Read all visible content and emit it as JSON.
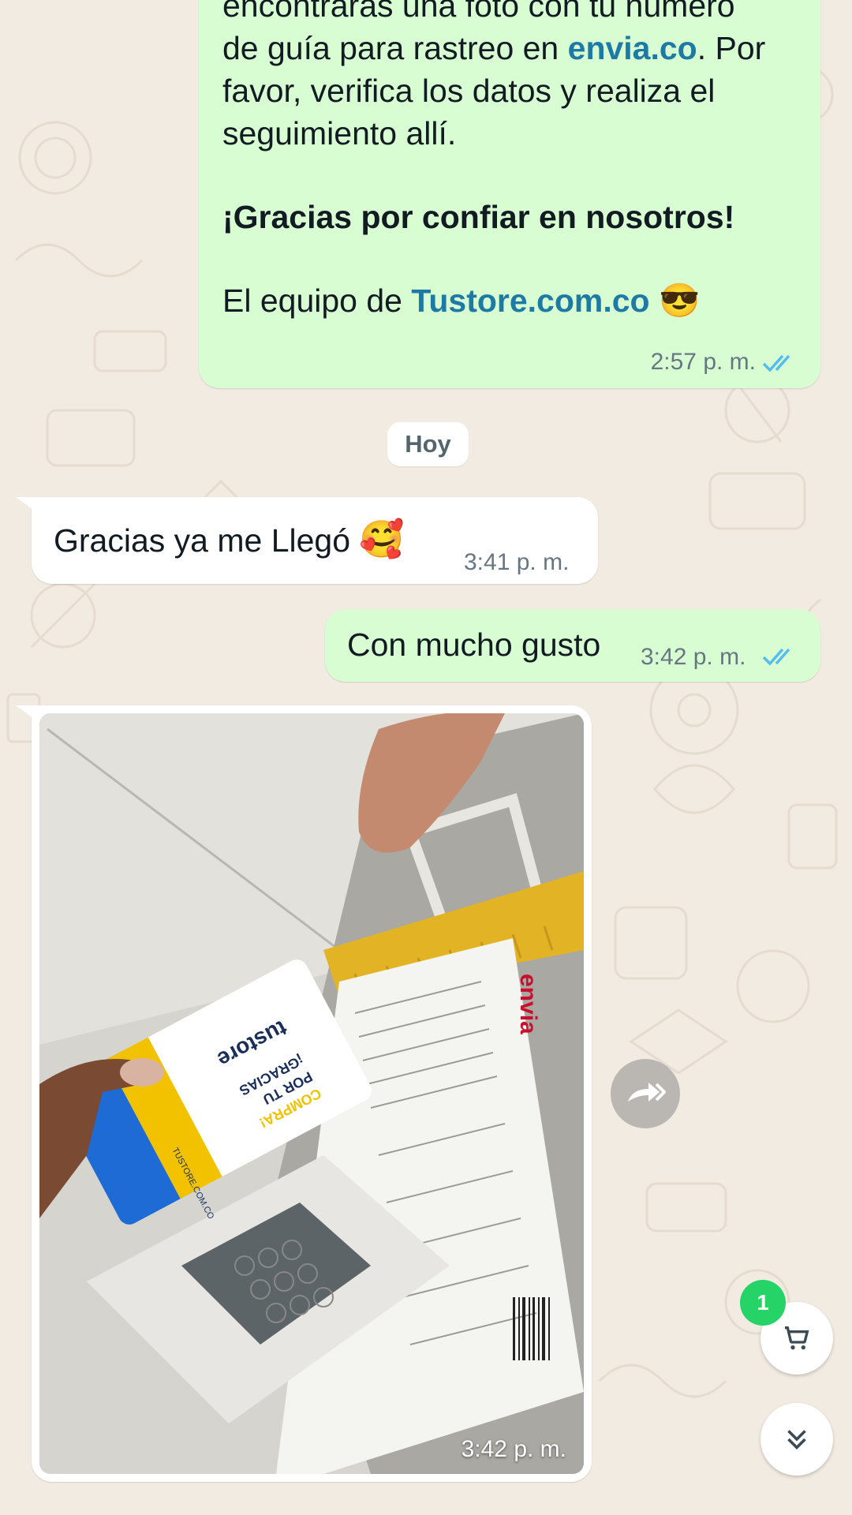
{
  "theme": {
    "outgoing_bubble": "#d9fdd3",
    "incoming_bubble": "#ffffff",
    "link": "#1d7aa5",
    "read_ticks": "#53bdeb",
    "badge": "#25d366",
    "background": "#f2ebe2"
  },
  "messages": {
    "first": {
      "line0": "encontrarás una foto con tu número",
      "line1_pre": "de guía para rastreo en ",
      "line1_link": "envia.co",
      "line1_post": ". Por",
      "line2": "favor, verifica los datos y realiza el",
      "line3": "seguimiento allí.",
      "thanks": "¡Gracias por confiar en nosotros!",
      "team_pre": "El equipo de ",
      "team_link": "Tustore.com.co",
      "emoji": "😎",
      "time": "2:57 p. m."
    },
    "date_separator": "Hoy",
    "incoming": {
      "text": "Gracias ya me Llegó",
      "emoji": "🥰",
      "time": "3:41 p. m."
    },
    "reply": {
      "text": "Con mucho gusto",
      "time": "3:42 p. m."
    },
    "photo": {
      "time": "3:42 p. m.",
      "card_brand": "tustore",
      "card_text_1": "¡GRACIAS",
      "card_text_2": "POR TU",
      "card_text_3": "COMPRA!",
      "card_web": "TUSTORE.COM.CO",
      "envia_brand": "envia"
    }
  },
  "controls": {
    "forward_icon": "forward-icon",
    "cart_badge": "1",
    "cart_icon": "cart-icon",
    "scroll_icon": "double-chevron-down-icon"
  }
}
